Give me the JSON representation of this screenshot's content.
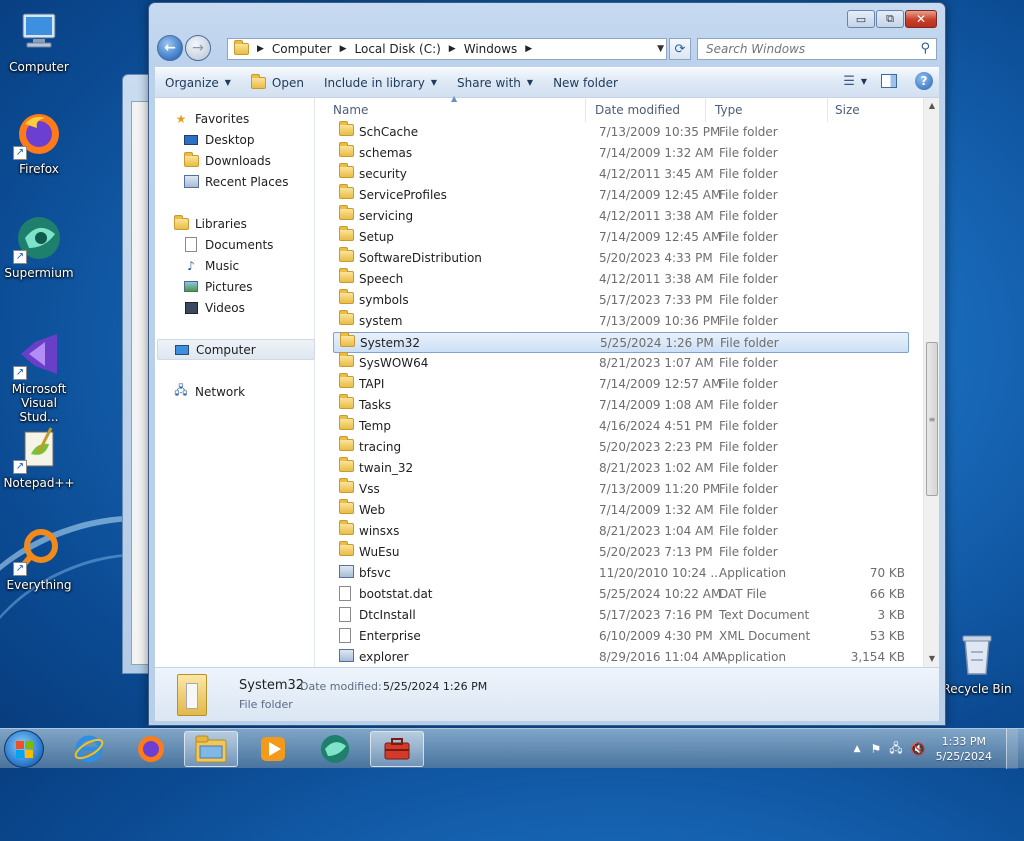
{
  "desktop": {
    "icons": [
      {
        "label": "Computer",
        "icon": "computer-icon"
      },
      {
        "label": "Firefox",
        "icon": "firefox-icon"
      },
      {
        "label": "Supermium",
        "icon": "supermium-icon"
      },
      {
        "label": "Microsoft Visual Stud...",
        "icon": "visual-studio-icon"
      },
      {
        "label": "Notepad++",
        "icon": "notepadpp-icon"
      },
      {
        "label": "Everything",
        "icon": "everything-icon"
      },
      {
        "label": "Recycle Bin",
        "icon": "recycle-bin-icon"
      }
    ]
  },
  "window": {
    "caption": {
      "minimize": "▭",
      "maximize": "⧉",
      "close": "✕"
    },
    "address": {
      "crumbs": [
        "Computer",
        "Local Disk (C:)",
        "Windows"
      ]
    },
    "search": {
      "placeholder": "Search Windows"
    },
    "toolbar": {
      "organize": "Organize",
      "open": "Open",
      "include": "Include in library",
      "share": "Share with",
      "new_folder": "New folder"
    },
    "nav": {
      "favorites": "Favorites",
      "desktop": "Desktop",
      "downloads": "Downloads",
      "recent": "Recent Places",
      "libraries": "Libraries",
      "documents": "Documents",
      "music": "Music",
      "pictures": "Pictures",
      "videos": "Videos",
      "computer": "Computer",
      "network": "Network"
    },
    "columns": {
      "name": "Name",
      "date": "Date modified",
      "type": "Type",
      "size": "Size"
    },
    "files": [
      {
        "name": "SchCache",
        "date": "7/13/2009 10:35 PM",
        "type": "File folder",
        "size": "",
        "kind": "folder"
      },
      {
        "name": "schemas",
        "date": "7/14/2009 1:32 AM",
        "type": "File folder",
        "size": "",
        "kind": "folder"
      },
      {
        "name": "security",
        "date": "4/12/2011 3:45 AM",
        "type": "File folder",
        "size": "",
        "kind": "folder"
      },
      {
        "name": "ServiceProfiles",
        "date": "7/14/2009 12:45 AM",
        "type": "File folder",
        "size": "",
        "kind": "folder"
      },
      {
        "name": "servicing",
        "date": "4/12/2011 3:38 AM",
        "type": "File folder",
        "size": "",
        "kind": "folder"
      },
      {
        "name": "Setup",
        "date": "7/14/2009 12:45 AM",
        "type": "File folder",
        "size": "",
        "kind": "folder"
      },
      {
        "name": "SoftwareDistribution",
        "date": "5/20/2023 4:33 PM",
        "type": "File folder",
        "size": "",
        "kind": "folder"
      },
      {
        "name": "Speech",
        "date": "4/12/2011 3:38 AM",
        "type": "File folder",
        "size": "",
        "kind": "folder"
      },
      {
        "name": "symbols",
        "date": "5/17/2023 7:33 PM",
        "type": "File folder",
        "size": "",
        "kind": "folder"
      },
      {
        "name": "system",
        "date": "7/13/2009 10:36 PM",
        "type": "File folder",
        "size": "",
        "kind": "folder"
      },
      {
        "name": "System32",
        "date": "5/25/2024 1:26 PM",
        "type": "File folder",
        "size": "",
        "kind": "folder",
        "selected": true
      },
      {
        "name": "SysWOW64",
        "date": "8/21/2023 1:07 AM",
        "type": "File folder",
        "size": "",
        "kind": "folder"
      },
      {
        "name": "TAPI",
        "date": "7/14/2009 12:57 AM",
        "type": "File folder",
        "size": "",
        "kind": "folder"
      },
      {
        "name": "Tasks",
        "date": "7/14/2009 1:08 AM",
        "type": "File folder",
        "size": "",
        "kind": "folder"
      },
      {
        "name": "Temp",
        "date": "4/16/2024 4:51 PM",
        "type": "File folder",
        "size": "",
        "kind": "folder"
      },
      {
        "name": "tracing",
        "date": "5/20/2023 2:23 PM",
        "type": "File folder",
        "size": "",
        "kind": "folder"
      },
      {
        "name": "twain_32",
        "date": "8/21/2023 1:02 AM",
        "type": "File folder",
        "size": "",
        "kind": "folder"
      },
      {
        "name": "Vss",
        "date": "7/13/2009 11:20 PM",
        "type": "File folder",
        "size": "",
        "kind": "folder"
      },
      {
        "name": "Web",
        "date": "7/14/2009 1:32 AM",
        "type": "File folder",
        "size": "",
        "kind": "folder"
      },
      {
        "name": "winsxs",
        "date": "8/21/2023 1:04 AM",
        "type": "File folder",
        "size": "",
        "kind": "folder"
      },
      {
        "name": "WuEsu",
        "date": "5/20/2023 7:13 PM",
        "type": "File folder",
        "size": "",
        "kind": "folder"
      },
      {
        "name": "bfsvc",
        "date": "11/20/2010 10:24 ...",
        "type": "Application",
        "size": "70 KB",
        "kind": "app"
      },
      {
        "name": "bootstat.dat",
        "date": "5/25/2024 10:22 AM",
        "type": "DAT File",
        "size": "66 KB",
        "kind": "file"
      },
      {
        "name": "DtcInstall",
        "date": "5/17/2023 7:16 PM",
        "type": "Text Document",
        "size": "3 KB",
        "kind": "file"
      },
      {
        "name": "Enterprise",
        "date": "6/10/2009 4:30 PM",
        "type": "XML Document",
        "size": "53 KB",
        "kind": "file"
      },
      {
        "name": "explorer",
        "date": "8/29/2016 11:04 AM",
        "type": "Application",
        "size": "3,154 KB",
        "kind": "app"
      }
    ],
    "details": {
      "name": "System32",
      "date_label": "Date modified:",
      "date": "5/25/2024 1:26 PM",
      "type": "File folder"
    }
  },
  "taskbar": {
    "buttons": [
      "internet-explorer-icon",
      "firefox-icon",
      "explorer-icon",
      "media-player-icon",
      "supermium-icon",
      "toolbox-icon"
    ],
    "clock": {
      "time": "1:33 PM",
      "date": "5/25/2024"
    }
  }
}
